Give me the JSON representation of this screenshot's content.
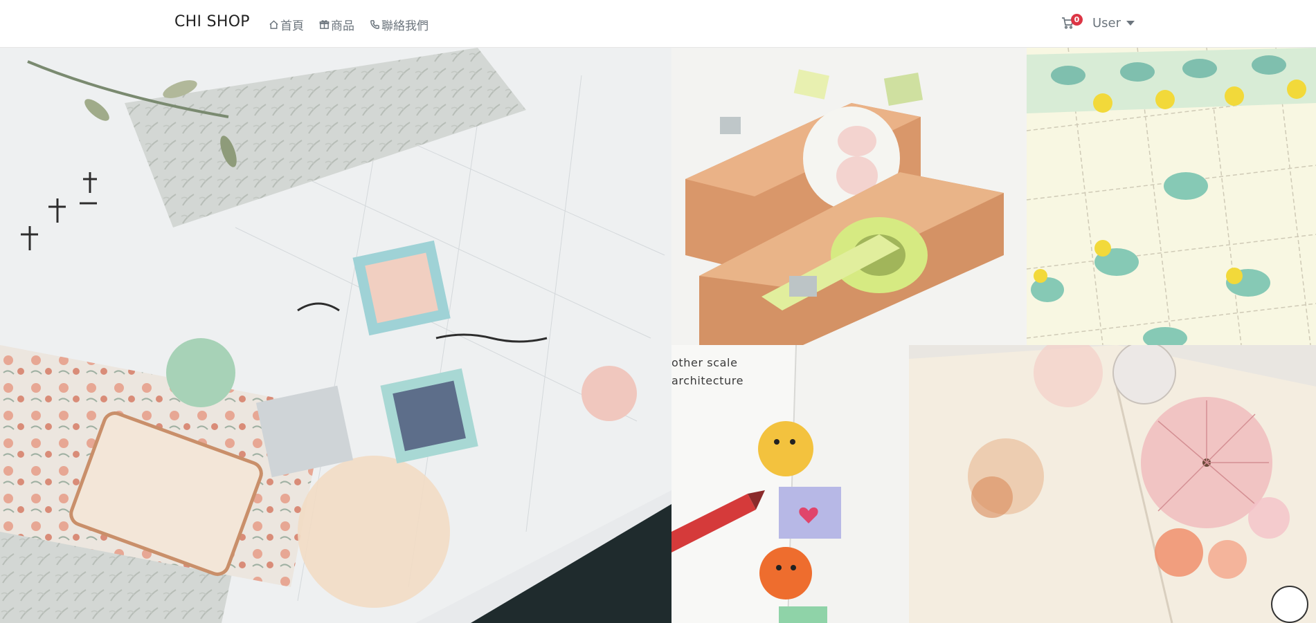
{
  "navbar": {
    "brand": "CHI SHOP",
    "links": [
      {
        "label": "首頁",
        "icon": "home-icon"
      },
      {
        "label": "商品",
        "icon": "gift-icon"
      },
      {
        "label": "聯絡我們",
        "icon": "phone-icon"
      }
    ],
    "cart": {
      "count": "0",
      "icon": "cart-icon"
    },
    "user_label": "User"
  },
  "gallery": {
    "photo_b_text": [
      "other scale",
      "architecture"
    ]
  },
  "colors": {
    "badge": "#dc3545",
    "nav_text": "#6c757d",
    "brand_text": "#222222"
  }
}
